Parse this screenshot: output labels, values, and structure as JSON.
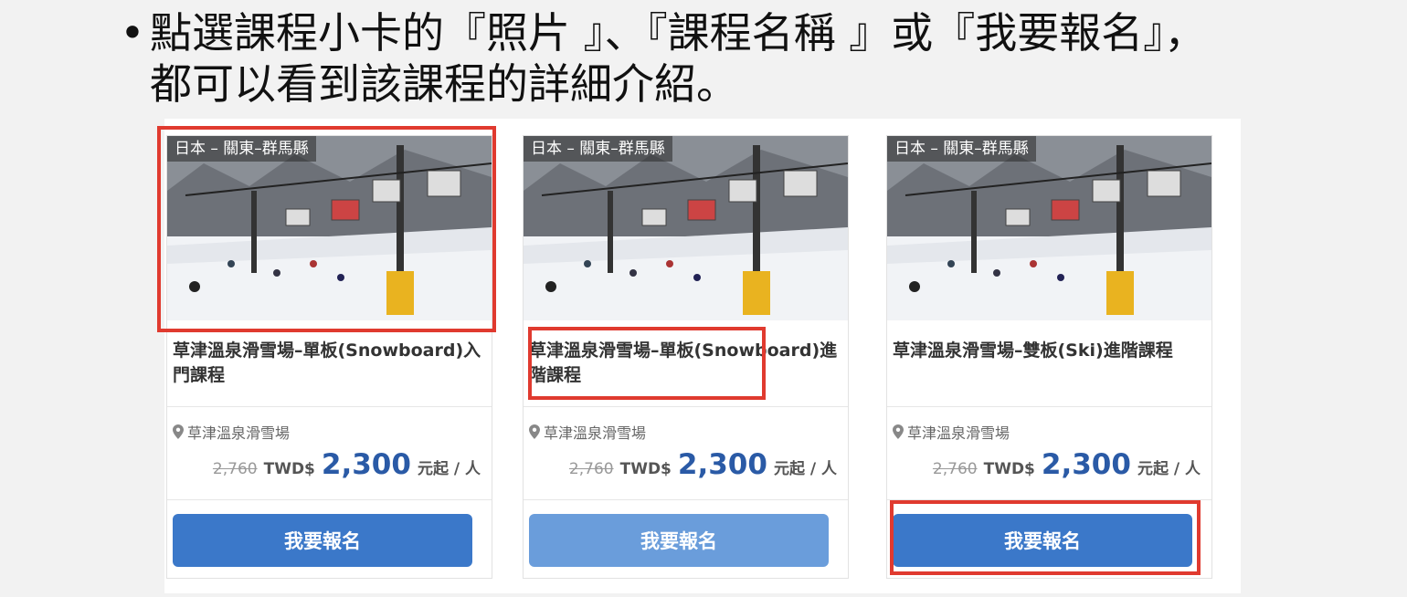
{
  "instruction": {
    "bullet": "•",
    "text": "點選課程小卡的『照片 』、『課程名稱 』或『我要報名』，都可以看到該課程的詳細介紹。"
  },
  "cards": [
    {
      "location_tag": "日本 – 關東–群馬縣",
      "title": "草津溫泉滑雪場–單板(Snowboard)入門課程",
      "venue": "草津溫泉滑雪場",
      "old_price": "2,760",
      "currency": "TWD$",
      "price": "2,300",
      "unit": "元起 / 人",
      "button": "我要報名"
    },
    {
      "location_tag": "日本 – 關東–群馬縣",
      "title": "草津溫泉滑雪場–單板(Snowboard)進階課程",
      "venue": "草津溫泉滑雪場",
      "old_price": "2,760",
      "currency": "TWD$",
      "price": "2,300",
      "unit": "元起 / 人",
      "button": "我要報名"
    },
    {
      "location_tag": "日本 – 關東–群馬縣",
      "title": "草津溫泉滑雪場–雙板(Ski)進階課程",
      "venue": "草津溫泉滑雪場",
      "old_price": "2,760",
      "currency": "TWD$",
      "price": "2,300",
      "unit": "元起 / 人",
      "button": "我要報名"
    }
  ],
  "colors": {
    "highlight": "#e03a2f",
    "button": "#3b78c9",
    "button_hover": "#6a9ddb",
    "price": "#2a5aa6"
  },
  "icons": {
    "venue": "map-pin-icon"
  }
}
